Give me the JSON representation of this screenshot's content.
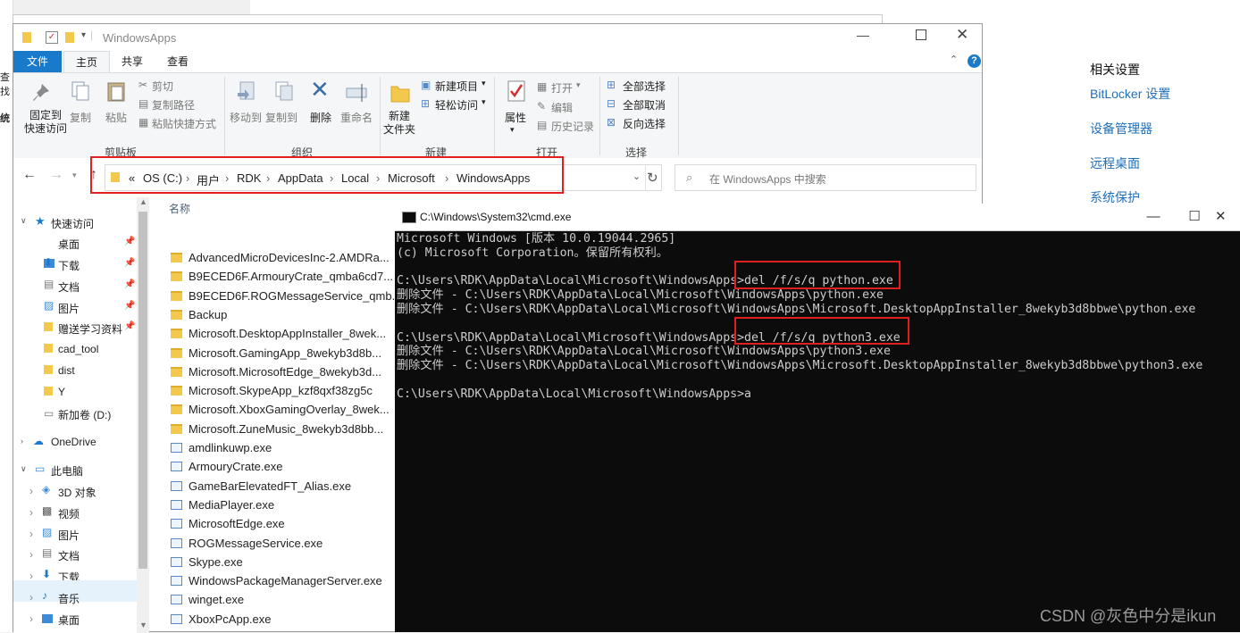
{
  "settings": {
    "section_title": "相关设置",
    "links": [
      "BitLocker 设置",
      "设备管理器",
      "远程桌面",
      "系统保护"
    ]
  },
  "left_strip": {
    "texts": [
      "查找",
      "统"
    ]
  },
  "explorer": {
    "title": "WindowsApps",
    "tabs": [
      "文件",
      "主页",
      "共享",
      "查看"
    ],
    "ribbon": {
      "clipboard": {
        "pin": "固定到\n快速访问",
        "copy": "复制",
        "paste": "粘贴",
        "cut": "剪切",
        "copy_path": "复制路径",
        "paste_shortcut": "粘贴快捷方式",
        "label": "剪贴板"
      },
      "organize": {
        "move_to": "移动到",
        "copy_to": "复制到",
        "delete": "删除",
        "rename": "重命名",
        "label": "组织"
      },
      "new": {
        "new_folder": "新建\n文件夹",
        "new_item": "新建项目",
        "easy_access": "轻松访问",
        "label": "新建"
      },
      "open": {
        "properties": "属性",
        "open": "打开",
        "edit": "编辑",
        "history": "历史记录",
        "label": "打开"
      },
      "select": {
        "select_all": "全部选择",
        "select_none": "全部取消",
        "invert": "反向选择",
        "label": "选择"
      }
    },
    "address": {
      "overflow": "«",
      "crumbs": [
        "OS (C:)",
        "用户",
        "RDK",
        "AppData",
        "Local",
        "Microsoft",
        "WindowsApps"
      ],
      "search_placeholder": "在 WindowsApps 中搜索"
    },
    "nav": {
      "quick_access": "快速访问",
      "items": [
        "桌面",
        "下载",
        "文档",
        "图片",
        "赠送学习资料",
        "cad_tool",
        "dist",
        "Y",
        "新加卷 (D:)"
      ],
      "onedrive": "OneDrive",
      "this_pc": "此电脑",
      "pc_items": [
        "3D 对象",
        "视频",
        "图片",
        "文档",
        "下载",
        "音乐",
        "桌面"
      ]
    },
    "column_name": "名称",
    "files": [
      {
        "name": "AdvancedMicroDevicesInc-2.AMDRa...",
        "type": "folder"
      },
      {
        "name": "B9ECED6F.ArmouryCrate_qmba6cd7...",
        "type": "folder"
      },
      {
        "name": "B9ECED6F.ROGMessageService_qmb...",
        "type": "folder"
      },
      {
        "name": "Backup",
        "type": "folder"
      },
      {
        "name": "Microsoft.DesktopAppInstaller_8wek...",
        "type": "folder"
      },
      {
        "name": "Microsoft.GamingApp_8wekyb3d8b...",
        "type": "folder"
      },
      {
        "name": "Microsoft.MicrosoftEdge_8wekyb3d...",
        "type": "folder"
      },
      {
        "name": "Microsoft.SkypeApp_kzf8qxf38zg5c",
        "type": "folder"
      },
      {
        "name": "Microsoft.XboxGamingOverlay_8wek...",
        "type": "folder"
      },
      {
        "name": "Microsoft.ZuneMusic_8wekyb3d8bb...",
        "type": "folder"
      },
      {
        "name": "amdlinkuwp.exe",
        "type": "exe"
      },
      {
        "name": "ArmouryCrate.exe",
        "type": "exe"
      },
      {
        "name": "GameBarElevatedFT_Alias.exe",
        "type": "exe"
      },
      {
        "name": "MediaPlayer.exe",
        "type": "exe"
      },
      {
        "name": "MicrosoftEdge.exe",
        "type": "exe"
      },
      {
        "name": "ROGMessageService.exe",
        "type": "exe"
      },
      {
        "name": "Skype.exe",
        "type": "exe"
      },
      {
        "name": "WindowsPackageManagerServer.exe",
        "type": "exe"
      },
      {
        "name": "winget.exe",
        "type": "exe"
      },
      {
        "name": "XboxPcApp.exe",
        "type": "exe"
      }
    ]
  },
  "cmd": {
    "title": "C:\\Windows\\System32\\cmd.exe",
    "lines": [
      "Microsoft Windows [版本 10.0.19044.2965]",
      "(c) Microsoft Corporation。保留所有权利。",
      "",
      "C:\\Users\\RDK\\AppData\\Local\\Microsoft\\WindowsApps>del /f/s/q python.exe",
      "删除文件 - C:\\Users\\RDK\\AppData\\Local\\Microsoft\\WindowsApps\\python.exe",
      "删除文件 - C:\\Users\\RDK\\AppData\\Local\\Microsoft\\WindowsApps\\Microsoft.DesktopAppInstaller_8wekyb3d8bbwe\\python.exe",
      "",
      "C:\\Users\\RDK\\AppData\\Local\\Microsoft\\WindowsApps>del /f/s/q python3.exe",
      "删除文件 - C:\\Users\\RDK\\AppData\\Local\\Microsoft\\WindowsApps\\python3.exe",
      "删除文件 - C:\\Users\\RDK\\AppData\\Local\\Microsoft\\WindowsApps\\Microsoft.DesktopAppInstaller_8wekyb3d8bbwe\\python3.exe",
      "",
      "C:\\Users\\RDK\\AppData\\Local\\Microsoft\\WindowsApps>a"
    ]
  },
  "watermark": "CSDN @灰色中分是ikun",
  "colors": {
    "accent": "#1f6fb8",
    "highlight": "#e02020",
    "console_bg": "#0c0c0c",
    "console_fg": "#cccccc"
  }
}
